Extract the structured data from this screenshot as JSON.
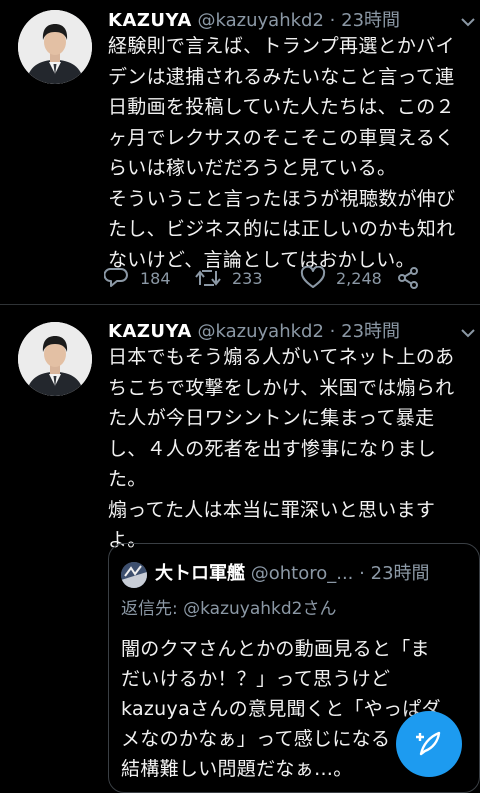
{
  "tweets": [
    {
      "display_name": "KAZUYA",
      "handle": "@kazuyahkd2",
      "time_sep": "·",
      "time": "23時間",
      "text": "経験則で言えば、トランプ再選とかバイ\nデンは逮捕されるみたいなこと言って連\n日動画を投稿していた人たちは、この２\nヶ月でレクサスのそこそこの車買えるく\nらいは稼いだだろうと見ている。\nそういうこと言ったほうが視聴数が伸び\nたし、ビジネス的には正しいのかも知れ\nないけど、言論としてはおかしい。",
      "replies": "184",
      "retweets": "233",
      "likes": "2,248"
    },
    {
      "display_name": "KAZUYA",
      "handle": "@kazuyahkd2",
      "time_sep": "·",
      "time": "23時間",
      "text": "日本でもそう煽る人がいてネット上のあ\nちこちで攻撃をしかけ、米国では煽られ\nた人が今日ワシントンに集まって暴走\nし、４人の死者を出す惨事になりまし\nた。\n煽ってた人は本当に罪深いと思います\nよ。",
      "quote": {
        "display_name": "大トロ軍艦",
        "handle": "@ohtoro_...",
        "time_sep": "·",
        "time": "23時間",
        "reply_to": "返信先: @kazuyahkd2さん",
        "text": "闇のクマさんとかの動画見ると「ま\nだいけるか！？」って思うけど\nkazuyaさんの意見聞くと「やっぱダ\nメなのかなぁ」って感じになる\n結構難しい問題だなぁ…。"
      }
    }
  ],
  "colors": {
    "accent": "#1d9bf0",
    "muted": "#8b98a5",
    "background": "#000000"
  },
  "icons": [
    "chevron-down-icon",
    "reply-icon",
    "retweet-icon",
    "like-icon",
    "share-icon",
    "compose-icon"
  ]
}
